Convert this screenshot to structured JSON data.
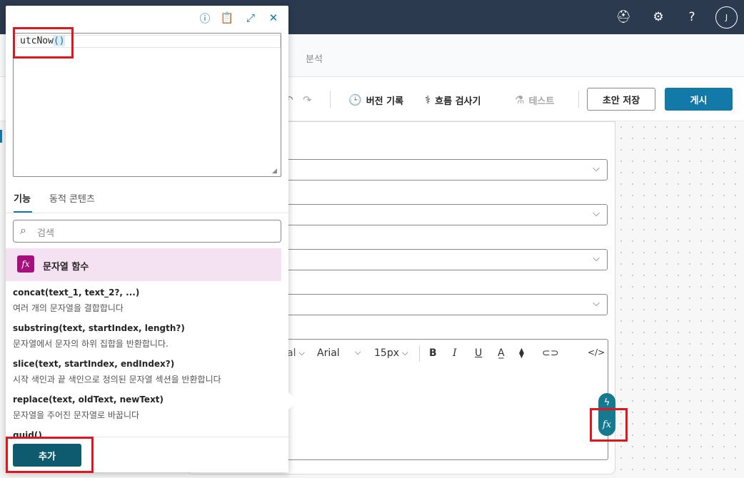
{
  "header": {
    "avatar_initial": "J",
    "icons": [
      "stethoscope-badge-icon",
      "gear-icon",
      "help-icon"
    ],
    "help_glyph": "?"
  },
  "tabs": {
    "analytics": "분석"
  },
  "command_bar": {
    "version_history": "버전 기록",
    "flow_checker": "흐름 검사기",
    "test": "테스트",
    "save_draft": "초안 저장",
    "publish": "게시"
  },
  "editor_toolbar": {
    "font_partial": "al",
    "font": "Arial",
    "font_size": "15px"
  },
  "expression_panel": {
    "expression": {
      "fn": "utcNow",
      "parens": "()"
    },
    "tabs": {
      "functions": "기능",
      "dynamic_content": "동적 콘텐츠"
    },
    "search_placeholder": "검색",
    "category": "문자열 함수",
    "functions": [
      {
        "signature": "concat(text_1, text_2?, ...)",
        "description": "여러 개의 문자열을 결합합니다"
      },
      {
        "signature": "substring(text, startIndex, length?)",
        "description": "문자열에서 문자의 하위 집합을 반환합니다."
      },
      {
        "signature": "slice(text, startIndex, endIndex?)",
        "description": "시작 색인과 끝 색인으로 정의된 문자열 섹션을 반환합니다"
      },
      {
        "signature": "replace(text, oldText, newText)",
        "description": "문자열을 주어진 문자열로 바꿉니다"
      },
      {
        "signature": "guid()",
        "description": ""
      }
    ],
    "add_button": "추가"
  },
  "colors": {
    "accent": "#1279a8",
    "topbar": "#2b3a4e",
    "highlight": "#e0161e"
  }
}
